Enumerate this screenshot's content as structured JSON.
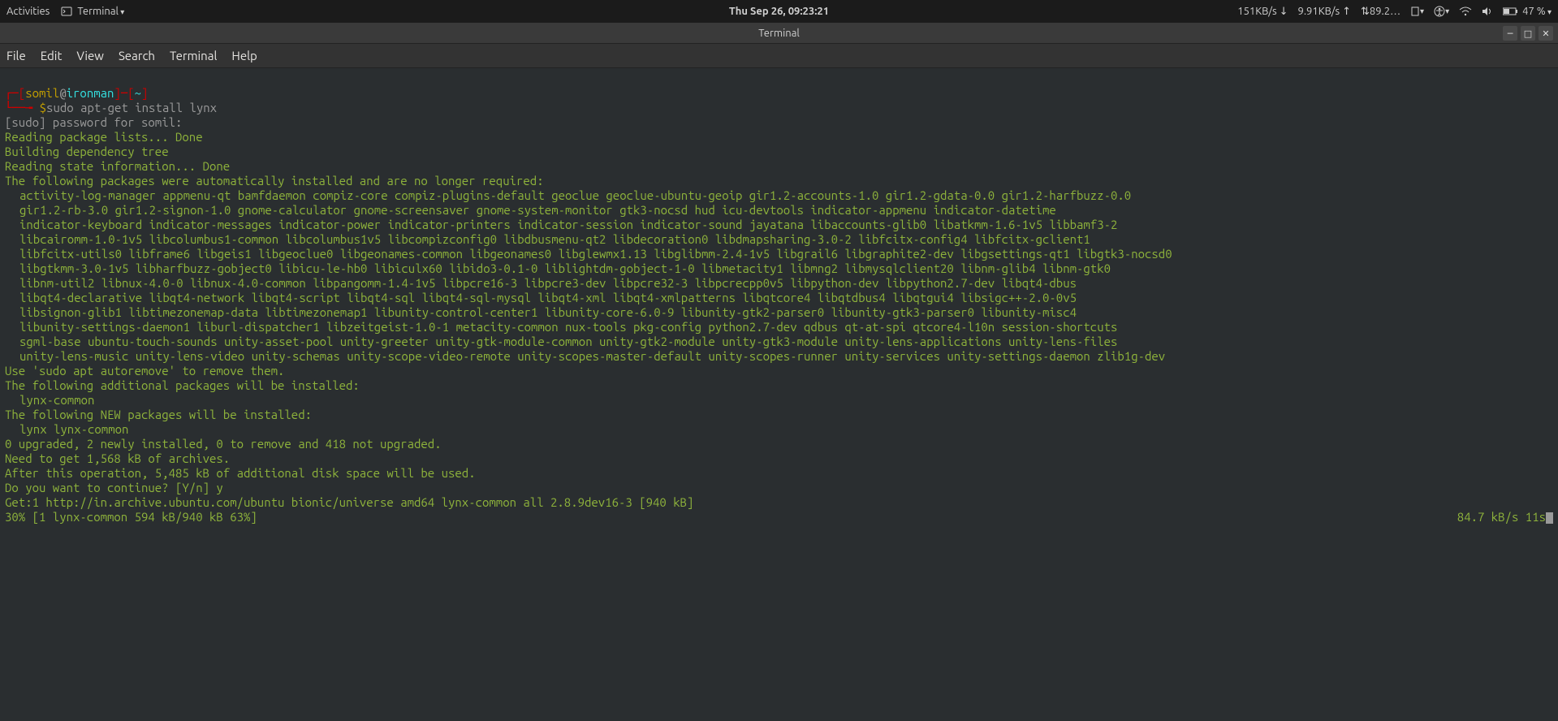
{
  "top_panel": {
    "activities": "Activities",
    "app_name": "Terminal",
    "clock": "Thu Sep 26, 09:23:21",
    "net_down": "151KB/s ↓",
    "net_up": "9.91KB/s ↑",
    "net_misc": "⇅89.2…",
    "battery": "47 %"
  },
  "window": {
    "title": "Terminal"
  },
  "menubar": {
    "file": "File",
    "edit": "Edit",
    "view": "View",
    "search": "Search",
    "terminal": "Terminal",
    "help": "Help"
  },
  "prompt": {
    "open": "┌─[",
    "user": "somil",
    "at": "@",
    "host": "ironman",
    "close": "]─[",
    "cwd": "~",
    "end": "]",
    "line2_pre": "└──╼ ",
    "dollar": "$",
    "command": "sudo apt-get install lynx"
  },
  "lines": {
    "sudo_pw": "[sudo] password for somil:",
    "read_pkg": "Reading package lists... Done",
    "build_dep": "Building dependency tree",
    "read_state": "Reading state information... Done",
    "auto_installed": "The following packages were automatically installed and are no longer required:",
    "pkg1": "activity-log-manager appmenu-qt bamfdaemon compiz-core compiz-plugins-default geoclue geoclue-ubuntu-geoip gir1.2-accounts-1.0 gir1.2-gdata-0.0 gir1.2-harfbuzz-0.0",
    "pkg2": "gir1.2-rb-3.0 gir1.2-signon-1.0 gnome-calculator gnome-screensaver gnome-system-monitor gtk3-nocsd hud icu-devtools indicator-appmenu indicator-datetime",
    "pkg3": "indicator-keyboard indicator-messages indicator-power indicator-printers indicator-session indicator-sound jayatana libaccounts-glib0 libatkmm-1.6-1v5 libbamf3-2",
    "pkg4": "libcairomm-1.0-1v5 libcolumbus1-common libcolumbus1v5 libcompizconfig0 libdbusmenu-qt2 libdecoration0 libdmapsharing-3.0-2 libfcitx-config4 libfcitx-gclient1",
    "pkg5": "libfcitx-utils0 libframe6 libgeis1 libgeoclue0 libgeonames-common libgeonames0 libglewmx1.13 libglibmm-2.4-1v5 libgrail6 libgraphite2-dev libgsettings-qt1 libgtk3-nocsd0",
    "pkg6": "libgtkmm-3.0-1v5 libharfbuzz-gobject0 libicu-le-hb0 libiculx60 libido3-0.1-0 liblightdm-gobject-1-0 libmetacity1 libmng2 libmysqlclient20 libnm-glib4 libnm-gtk0",
    "pkg7": "libnm-util2 libnux-4.0-0 libnux-4.0-common libpangomm-1.4-1v5 libpcre16-3 libpcre3-dev libpcre32-3 libpcrecpp0v5 libpython-dev libpython2.7-dev libqt4-dbus",
    "pkg8": "libqt4-declarative libqt4-network libqt4-script libqt4-sql libqt4-sql-mysql libqt4-xml libqt4-xmlpatterns libqtcore4 libqtdbus4 libqtgui4 libsigc++-2.0-0v5",
    "pkg9": "libsignon-glib1 libtimezonemap-data libtimezonemap1 libunity-control-center1 libunity-core-6.0-9 libunity-gtk2-parser0 libunity-gtk3-parser0 libunity-misc4",
    "pkg10": "libunity-settings-daemon1 liburl-dispatcher1 libzeitgeist-1.0-1 metacity-common nux-tools pkg-config python2.7-dev qdbus qt-at-spi qtcore4-l10n session-shortcuts",
    "pkg11": "sgml-base ubuntu-touch-sounds unity-asset-pool unity-greeter unity-gtk-module-common unity-gtk2-module unity-gtk3-module unity-lens-applications unity-lens-files",
    "pkg12": "unity-lens-music unity-lens-video unity-schemas unity-scope-video-remote unity-scopes-master-default unity-scopes-runner unity-services unity-settings-daemon zlib1g-dev",
    "autoremove": "Use 'sudo apt autoremove' to remove them.",
    "additional": "The following additional packages will be installed:",
    "additional_pkgs": "lynx-common",
    "newpkgs": "The following NEW packages will be installed:",
    "newpkgs_list": "lynx lynx-common",
    "summary": "0 upgraded, 2 newly installed, 0 to remove and 418 not upgraded.",
    "need_get": "Need to get 1,568 kB of archives.",
    "after_op": "After this operation, 5,485 kB of additional disk space will be used.",
    "continue": "Do you want to continue? [Y/n] y",
    "get1": "Get:1 http://in.archive.ubuntu.com/ubuntu bionic/universe amd64 lynx-common all 2.8.9dev16-3 [940 kB]",
    "progress_left": "30% [1 lynx-common 594 kB/940 kB 63%]",
    "progress_right": "84.7 kB/s 11s"
  }
}
